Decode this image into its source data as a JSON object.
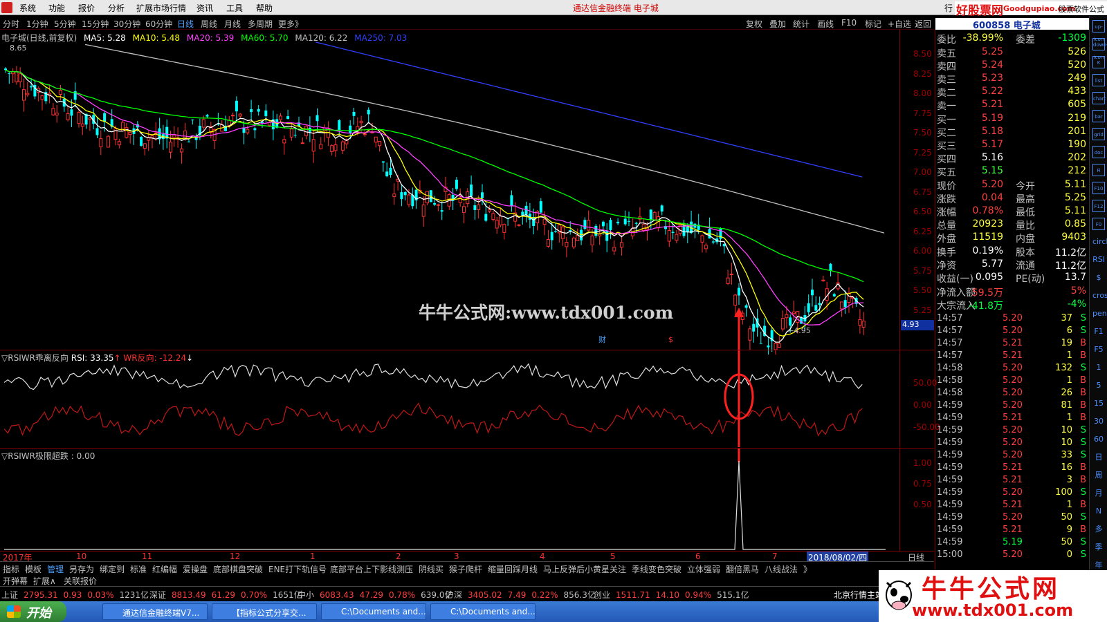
{
  "menu": [
    "系统",
    "功能",
    "报价",
    "分析",
    "扩展市场行情",
    "资讯",
    "工具",
    "帮助"
  ],
  "app_title": "通达信金融终端 电子城",
  "top_right": {
    "menu_partial": "行",
    "brand": "好股票网",
    "domain": "Goodgupiao.com",
    "software": "股票软件公式"
  },
  "period_tabs": [
    "分时",
    "1分钟",
    "5分钟",
    "15分钟",
    "30分钟",
    "60分钟",
    "日线",
    "周线",
    "月线",
    "多周期",
    "更多》"
  ],
  "active_period": "日线",
  "right_tabs": [
    "复权",
    "叠加",
    "统计",
    "画线",
    "F10",
    "标记",
    "+自选",
    "返回"
  ],
  "main_title": {
    "name": "电子城(日线,前复权)",
    "ma5": "MA5: 5.28",
    "ma10": "MA10: 5.48",
    "ma20": "MA20: 5.39",
    "ma60": "MA60: 5.70",
    "ma120": "MA120: 6.22",
    "ma250": "MA250: 7.03"
  },
  "price_axis": [
    "8.50",
    "8.25",
    "8.00",
    "7.75",
    "7.50",
    "7.25",
    "7.00",
    "6.75",
    "6.50",
    "6.25",
    "6.00",
    "5.75",
    "5.50",
    "5.25"
  ],
  "current_price_label": "4.93",
  "high_mark": "8.65",
  "low_mark": "←4.95",
  "markers": {
    "cai": "财",
    "dollar": "$"
  },
  "watermark": "牛牛公式网:www.tdx001.com",
  "panel1": {
    "name": "RSIWR乖离反向",
    "rsi": "RSI: 33.35",
    "wr": "WR反向: -12.24",
    "axis": [
      "50.00",
      "0.00",
      "-50.00"
    ]
  },
  "panel2": {
    "name": "RSIWR极限超跌",
    "value": ": 0.00",
    "axis": [
      "1.00",
      "0.75",
      "0.50"
    ]
  },
  "date_axis": [
    "2017年",
    "10",
    "11",
    "12",
    "1",
    "2",
    "3",
    "4",
    "5",
    "6",
    "7",
    "2018/08/02/四"
  ],
  "date_axis_right": "日线",
  "quote": {
    "code": "600858 电子城",
    "weibi": {
      "label": "委比",
      "value": "-38.99%",
      "label2": "委差",
      "value2": "-1309"
    },
    "asks": [
      {
        "label": "卖五",
        "price": "5.25",
        "vol": "526"
      },
      {
        "label": "卖四",
        "price": "5.24",
        "vol": "520"
      },
      {
        "label": "卖三",
        "price": "5.23",
        "vol": "249"
      },
      {
        "label": "卖二",
        "price": "5.22",
        "vol": "433"
      },
      {
        "label": "卖一",
        "price": "5.21",
        "vol": "605"
      }
    ],
    "bids": [
      {
        "label": "买一",
        "price": "5.19",
        "vol": "219"
      },
      {
        "label": "买二",
        "price": "5.18",
        "vol": "201"
      },
      {
        "label": "买三",
        "price": "5.17",
        "vol": "190"
      },
      {
        "label": "买四",
        "price": "5.16",
        "vol": "202"
      },
      {
        "label": "买五",
        "price": "5.15",
        "vol": "212"
      }
    ],
    "stats": [
      {
        "a": "现价",
        "b": "5.20",
        "c": "今开",
        "d": "5.11"
      },
      {
        "a": "涨跌",
        "b": "0.04",
        "c": "最高",
        "d": "5.25"
      },
      {
        "a": "涨幅",
        "b": "0.78%",
        "c": "最低",
        "d": "5.11"
      },
      {
        "a": "总量",
        "b": "20923",
        "c": "量比",
        "d": "0.85"
      },
      {
        "a": "外盘",
        "b": "11519",
        "c": "内盘",
        "d": "9403"
      }
    ],
    "stats2": [
      {
        "a": "换手",
        "b": "0.19%",
        "c": "股本",
        "d": "11.2亿"
      },
      {
        "a": "净资",
        "b": "5.77",
        "c": "流通",
        "d": "11.2亿"
      },
      {
        "a": "收益(一)",
        "b": "0.095",
        "c": "PE(动)",
        "d": "13.7"
      }
    ],
    "flows": [
      {
        "a": "净流入额",
        "b": "59.5万",
        "c": "5%"
      },
      {
        "a": "大宗流入",
        "b": "-41.8万",
        "c": "-4%"
      }
    ],
    "ticks": [
      [
        "14:57",
        "5.20",
        "37",
        "S"
      ],
      [
        "14:57",
        "5.20",
        "6",
        "S"
      ],
      [
        "14:57",
        "5.21",
        "19",
        "B"
      ],
      [
        "14:57",
        "5.21",
        "1",
        "B"
      ],
      [
        "14:58",
        "5.20",
        "132",
        "S"
      ],
      [
        "14:58",
        "5.20",
        "1",
        "B"
      ],
      [
        "14:58",
        "5.20",
        "26",
        "B"
      ],
      [
        "14:59",
        "5.20",
        "81",
        "B"
      ],
      [
        "14:59",
        "5.21",
        "1",
        "B"
      ],
      [
        "14:59",
        "5.20",
        "10",
        "S"
      ],
      [
        "14:59",
        "5.20",
        "10",
        "S"
      ],
      [
        "14:59",
        "5.20",
        "33",
        "S"
      ],
      [
        "14:59",
        "5.21",
        "16",
        "B"
      ],
      [
        "14:59",
        "5.21",
        "3",
        "B"
      ],
      [
        "14:59",
        "5.20",
        "100",
        "S"
      ],
      [
        "14:59",
        "5.21",
        "1",
        "B"
      ],
      [
        "14:59",
        "5.20",
        "50",
        "S"
      ],
      [
        "14:59",
        "5.21",
        "9",
        "B"
      ],
      [
        "14:59",
        "5.19",
        "50",
        "S"
      ],
      [
        "15:00",
        "5.20",
        "0",
        "S"
      ]
    ]
  },
  "side_icons": [
    "up-icon",
    "down-icon",
    "K",
    "list",
    "chart",
    "bar",
    "grid",
    "doc",
    "Fi",
    "F10",
    "F12",
    "F0",
    "circle",
    "RSI",
    "$",
    "cross",
    "pen",
    "F1",
    "F5",
    "1",
    "5",
    "15",
    "30",
    "60",
    "日",
    "周",
    "月",
    "N",
    "多",
    "季",
    "年"
  ],
  "formula_tabs": [
    "指标",
    "模板",
    "管理",
    "另存为",
    "绑定到",
    "标准",
    "红编幅",
    "爱操盘",
    "底部棋盘突破",
    "ENE打下轨信号",
    "底部平台上下影线测压",
    "阴线买",
    "猴子爬杆",
    "缩量回踩月线",
    "马上反弹后小黄星关注",
    "季线变色突破",
    "立体强弱",
    "翻倍黑马",
    "八线战法",
    "》"
  ],
  "sub_tabs": [
    "开弹幕",
    "扩展∧",
    "关联报价"
  ],
  "status": [
    {
      "n": "上证",
      "v": "2795.31",
      "c": "0.93",
      "p": "0.03%",
      "a": "1231亿"
    },
    {
      "n": "深证",
      "v": "8813.49",
      "c": "61.29",
      "p": "0.70%",
      "a": "1651亿"
    },
    {
      "n": "中小",
      "v": "6083.43",
      "c": "47.29",
      "p": "0.78%",
      "a": "639.0亿"
    },
    {
      "n": "沪深",
      "v": "3405.02",
      "c": "7.49",
      "p": "0.22%",
      "a": "856.3亿"
    },
    {
      "n": "创业",
      "v": "1511.71",
      "c": "14.10",
      "p": "0.94%",
      "a": "515.1亿"
    }
  ],
  "status_right": "北京行情主站",
  "taskbar": {
    "start": "开始",
    "tasks": [
      "通达信金融终端V7...",
      "【指标公式分享交...",
      "C:\\Documents and...",
      "C:\\Documents and..."
    ]
  },
  "bigbrand": {
    "cn": "牛牛公式网",
    "en": "www.tdx001.com"
  },
  "colors": {
    "ma5": "#ffffff",
    "ma10": "#ffff00",
    "ma20": "#ff40ff",
    "ma60": "#00ff00",
    "ma120": "#c0c0c0",
    "ma250": "#3040ff",
    "up": "#ff3030",
    "down": "#00ffff",
    "accent": "#ff2020"
  }
}
